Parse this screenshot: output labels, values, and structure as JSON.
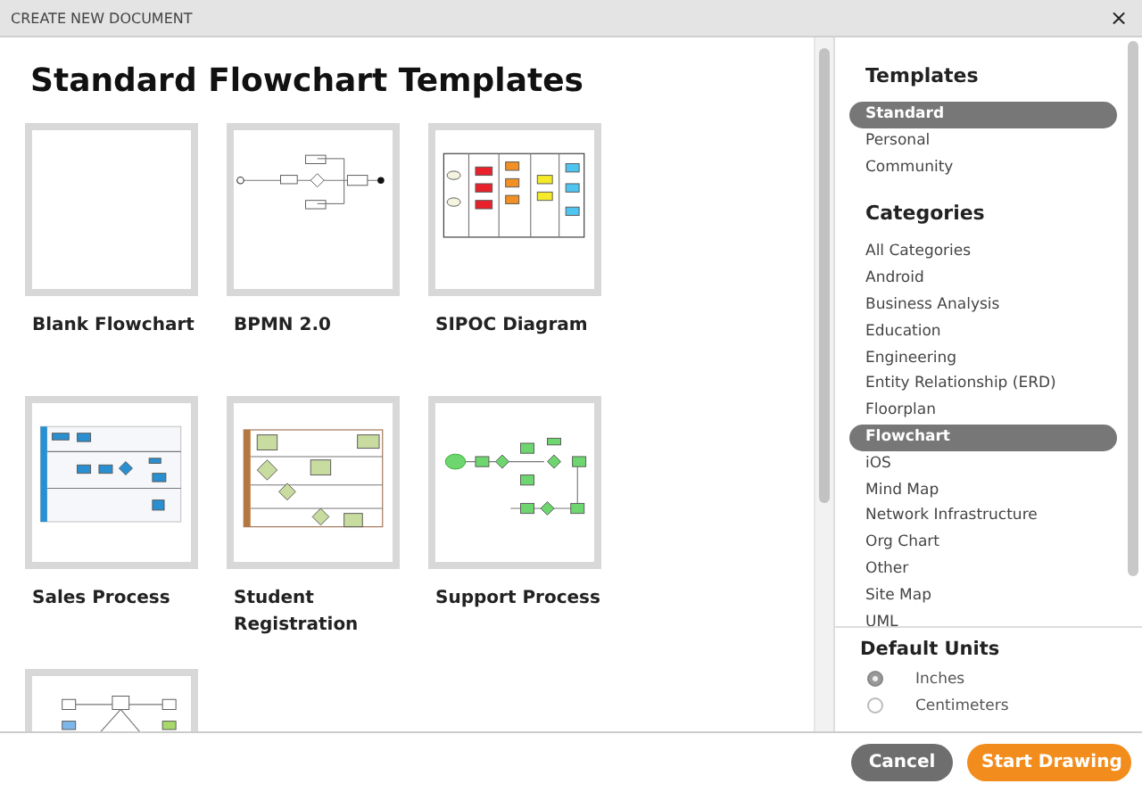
{
  "window": {
    "title": "CREATE NEW DOCUMENT",
    "close": "×"
  },
  "heading": "Standard Flowchart Templates",
  "templates": [
    {
      "kind": "blank",
      "label": "Blank Flowchart"
    },
    {
      "kind": "bpmn",
      "label": "BPMN 2.0"
    },
    {
      "kind": "sipoc",
      "label": "SIPOC Diagram"
    },
    {
      "kind": "sales",
      "label": "Sales Process"
    },
    {
      "kind": "student",
      "label": "Student Registration"
    },
    {
      "kind": "support",
      "label": "Support Process"
    },
    {
      "kind": "network"
    }
  ],
  "sidebar": {
    "templates_title": "Templates",
    "templates": [
      {
        "label": "Standard",
        "selected": true
      },
      {
        "label": "Personal",
        "selected": false
      },
      {
        "label": "Community",
        "selected": false
      }
    ],
    "categories_title": "Categories",
    "categories": [
      {
        "label": "All Categories",
        "selected": false
      },
      {
        "label": "Android",
        "selected": false
      },
      {
        "label": "Business Analysis",
        "selected": false
      },
      {
        "label": "Education",
        "selected": false
      },
      {
        "label": "Engineering",
        "selected": false
      },
      {
        "label": "Entity Relationship (ERD)",
        "selected": false
      },
      {
        "label": "Floorplan",
        "selected": false
      },
      {
        "label": "Flowchart",
        "selected": true
      },
      {
        "label": "iOS",
        "selected": false
      },
      {
        "label": "Mind Map",
        "selected": false
      },
      {
        "label": "Network Infrastructure",
        "selected": false
      },
      {
        "label": "Org Chart",
        "selected": false
      },
      {
        "label": "Other",
        "selected": false
      },
      {
        "label": "Site Map",
        "selected": false
      },
      {
        "label": "UML",
        "selected": false
      }
    ],
    "units_title": "Default Units",
    "units": [
      {
        "label": "Inches",
        "selected": true
      },
      {
        "label": "Centimeters",
        "selected": false
      }
    ]
  },
  "buttons": {
    "cancel": "Cancel",
    "start": "Start Drawing"
  }
}
